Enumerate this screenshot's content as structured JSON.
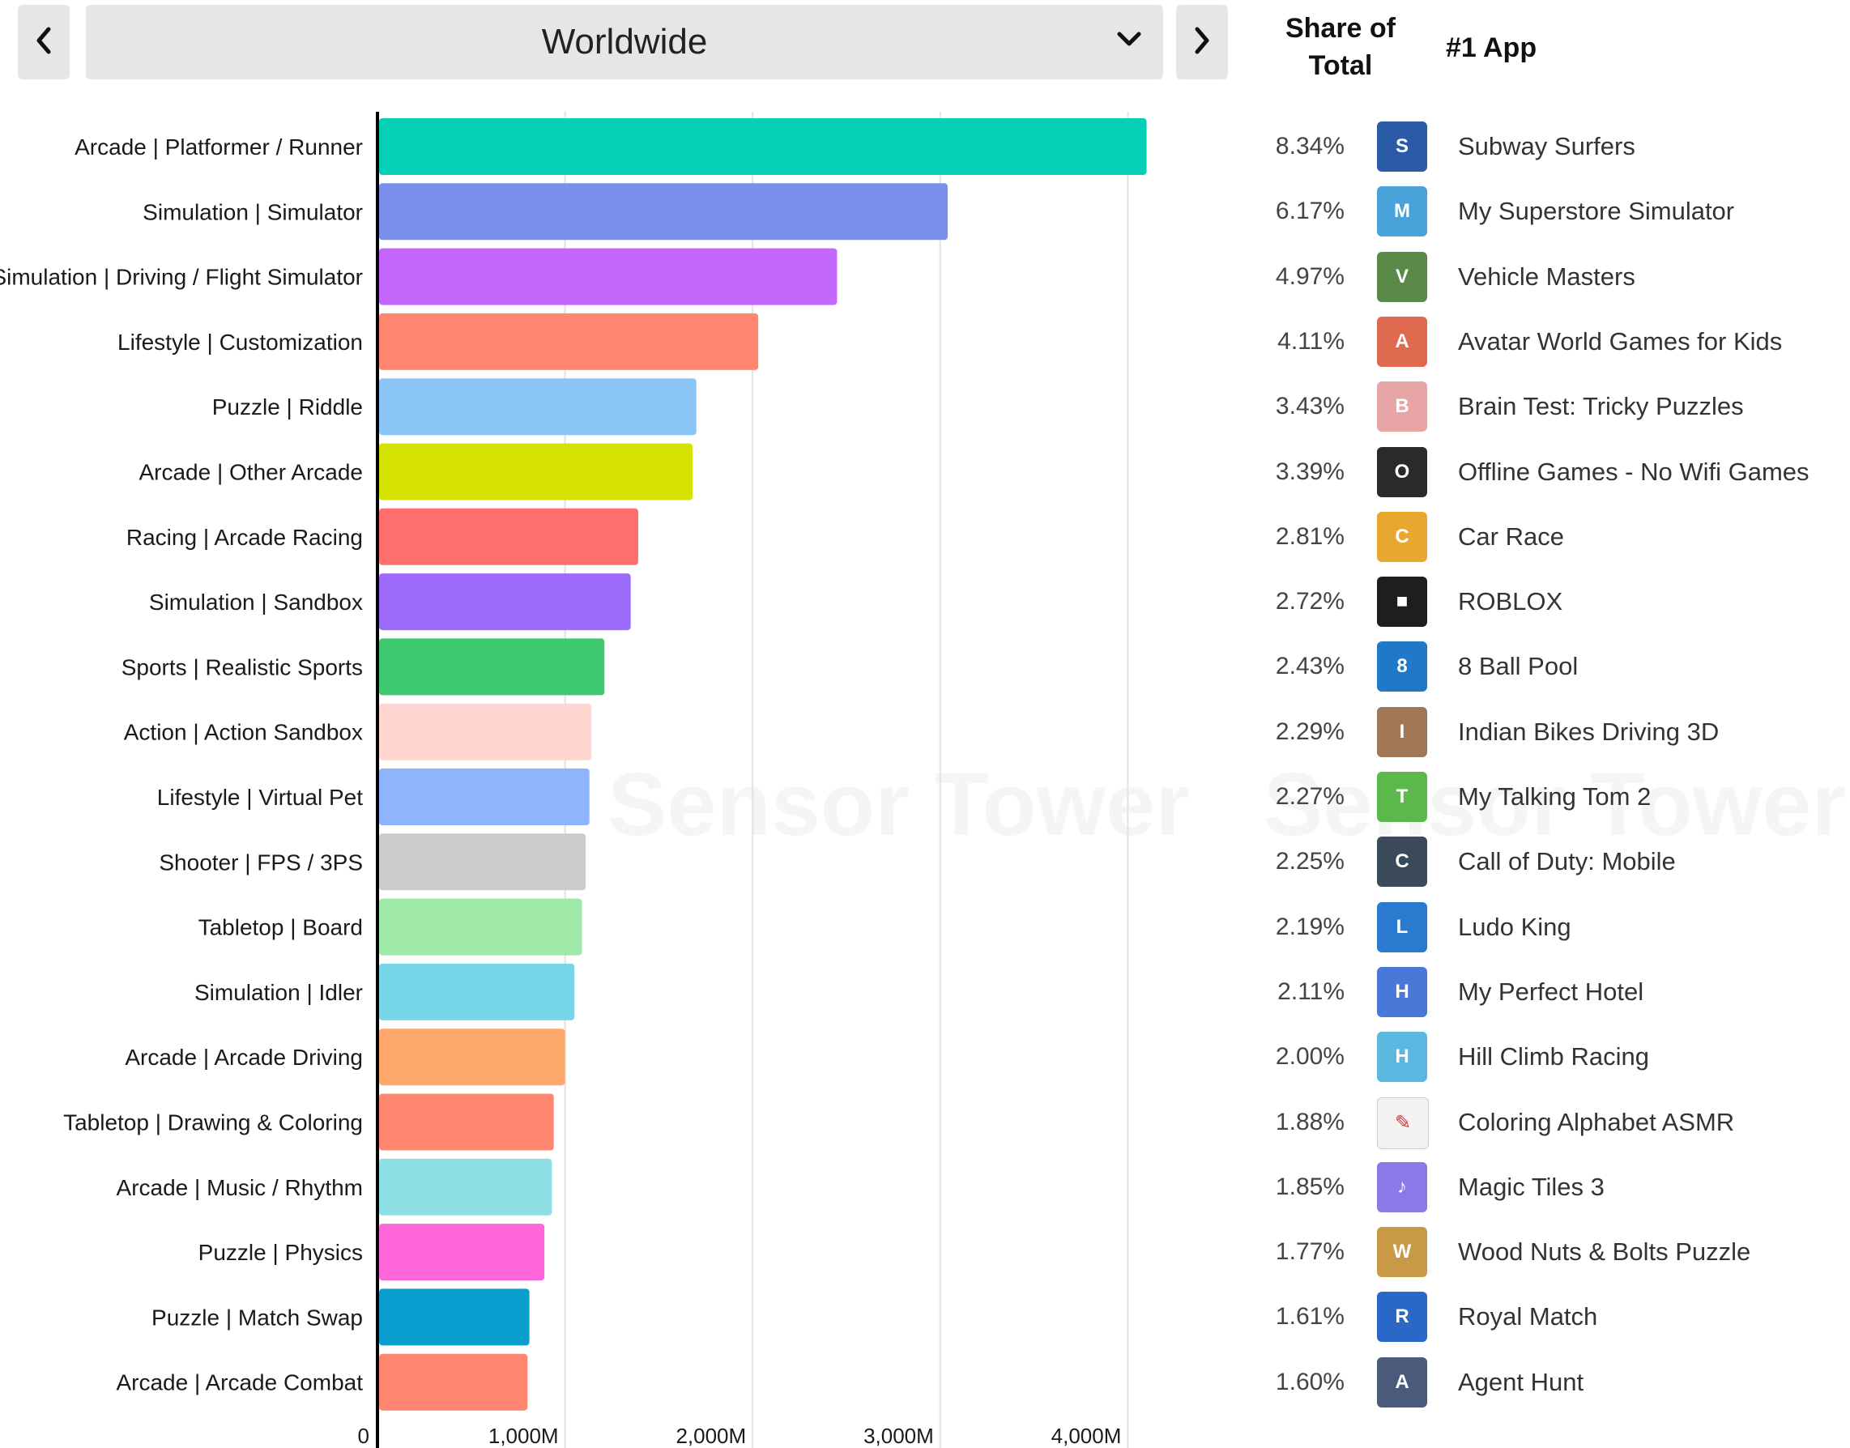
{
  "header": {
    "region": "Worldwide",
    "share_of_total": "Share of Total",
    "share_of_total_line1": "Share of",
    "share_of_total_line2": "Total",
    "top_app": "#1 App"
  },
  "watermark": "Sensor Tower",
  "chart_data": {
    "type": "bar",
    "orientation": "horizontal",
    "title": "",
    "xlabel": "",
    "ylabel": "",
    "xlim": [
      0,
      4000
    ],
    "x_unit": "M",
    "x_ticks": [
      "0",
      "1,000M",
      "2,000M",
      "3,000M",
      "4,000M"
    ],
    "x_tick_values": [
      0,
      1000,
      2000,
      3000,
      4000
    ],
    "grid": true,
    "legend": "none",
    "categories": [
      "Arcade | Platformer / Runner",
      "Simulation | Simulator",
      "Simulation | Driving / Flight Simulator",
      "Lifestyle | Customization",
      "Puzzle | Riddle",
      "Arcade | Other Arcade",
      "Racing | Arcade Racing",
      "Simulation | Sandbox",
      "Sports | Realistic Sports",
      "Action | Action Sandbox",
      "Lifestyle | Virtual Pet",
      "Shooter | FPS / 3PS",
      "Tabletop | Board",
      "Simulation | Idler",
      "Arcade | Arcade Driving",
      "Tabletop | Drawing & Coloring",
      "Arcade | Music / Rhythm",
      "Puzzle | Physics",
      "Puzzle | Match Swap",
      "Arcade | Arcade Combat"
    ],
    "values": [
      4100,
      3040,
      2450,
      2030,
      1700,
      1680,
      1390,
      1350,
      1210,
      1140,
      1130,
      1110,
      1090,
      1050,
      1000,
      940,
      930,
      890,
      810,
      800
    ],
    "colors": [
      "#06cfb8",
      "#7b8fed",
      "#c567fb",
      "#ff8670",
      "#8bc5f5",
      "#d5e100",
      "#ff6e6e",
      "#9d6bfb",
      "#3ec86f",
      "#ffd6d0",
      "#8fb4fc",
      "#cccccc",
      "#9ee8a8",
      "#78d6ea",
      "#ffa86b",
      "#ff8670",
      "#8ee0e6",
      "#ff66da",
      "#0a9ecf",
      "#ff8670"
    ]
  },
  "rows": [
    {
      "share": "8.34%",
      "app": "Subway Surfers",
      "icon": "subway-surfers-icon",
      "icon_color": "#2b5aa8",
      "icon_glyph": "S"
    },
    {
      "share": "6.17%",
      "app": "My Superstore Simulator",
      "icon": "my-superstore-simulator-icon",
      "icon_color": "#4aa3d8",
      "icon_glyph": "M"
    },
    {
      "share": "4.97%",
      "app": "Vehicle Masters",
      "icon": "vehicle-masters-icon",
      "icon_color": "#5a8a4a",
      "icon_glyph": "V"
    },
    {
      "share": "4.11%",
      "app": "Avatar World Games for Kids",
      "icon": "avatar-world-icon",
      "icon_color": "#e06a50",
      "icon_glyph": "A"
    },
    {
      "share": "3.43%",
      "app": "Brain Test: Tricky Puzzles",
      "icon": "brain-test-icon",
      "icon_color": "#e8a5a5",
      "icon_glyph": "B"
    },
    {
      "share": "3.39%",
      "app": "Offline Games - No Wifi Games",
      "icon": "offline-games-icon",
      "icon_color": "#2a2a2a",
      "icon_glyph": "O"
    },
    {
      "share": "2.81%",
      "app": "Car Race",
      "icon": "car-race-icon",
      "icon_color": "#e8a830",
      "icon_glyph": "C"
    },
    {
      "share": "2.72%",
      "app": "ROBLOX",
      "icon": "roblox-icon",
      "icon_color": "#1e1e1e",
      "icon_glyph": "■"
    },
    {
      "share": "2.43%",
      "app": "8 Ball Pool",
      "icon": "8-ball-pool-icon",
      "icon_color": "#1f78c8",
      "icon_glyph": "8"
    },
    {
      "share": "2.29%",
      "app": "Indian Bikes Driving 3D",
      "icon": "indian-bikes-icon",
      "icon_color": "#a07858",
      "icon_glyph": "I"
    },
    {
      "share": "2.27%",
      "app": "My Talking Tom 2",
      "icon": "my-talking-tom-icon",
      "icon_color": "#5cb84a",
      "icon_glyph": "T"
    },
    {
      "share": "2.25%",
      "app": "Call of Duty: Mobile",
      "icon": "call-of-duty-icon",
      "icon_color": "#3a4a5a",
      "icon_glyph": "C"
    },
    {
      "share": "2.19%",
      "app": "Ludo King",
      "icon": "ludo-king-icon",
      "icon_color": "#2a7ad0",
      "icon_glyph": "L"
    },
    {
      "share": "2.11%",
      "app": "My Perfect Hotel",
      "icon": "my-perfect-hotel-icon",
      "icon_color": "#4a78d8",
      "icon_glyph": "H"
    },
    {
      "share": "2.00%",
      "app": "Hill Climb Racing",
      "icon": "hill-climb-racing-icon",
      "icon_color": "#5ab8e0",
      "icon_glyph": "H"
    },
    {
      "share": "1.88%",
      "app": "Coloring Alphabet ASMR",
      "icon": "coloring-alphabet-icon",
      "icon_color": "#f2f2f2",
      "icon_glyph": "✎"
    },
    {
      "share": "1.85%",
      "app": "Magic Tiles 3",
      "icon": "magic-tiles-icon",
      "icon_color": "#8a7ae8",
      "icon_glyph": "♪"
    },
    {
      "share": "1.77%",
      "app": "Wood Nuts & Bolts Puzzle",
      "icon": "wood-nuts-bolts-icon",
      "icon_color": "#c89a48",
      "icon_glyph": "W"
    },
    {
      "share": "1.61%",
      "app": "Royal Match",
      "icon": "royal-match-icon",
      "icon_color": "#2a68c8",
      "icon_glyph": "R"
    },
    {
      "share": "1.60%",
      "app": "Agent Hunt",
      "icon": "agent-hunt-icon",
      "icon_color": "#4a5a7a",
      "icon_glyph": "A"
    }
  ]
}
